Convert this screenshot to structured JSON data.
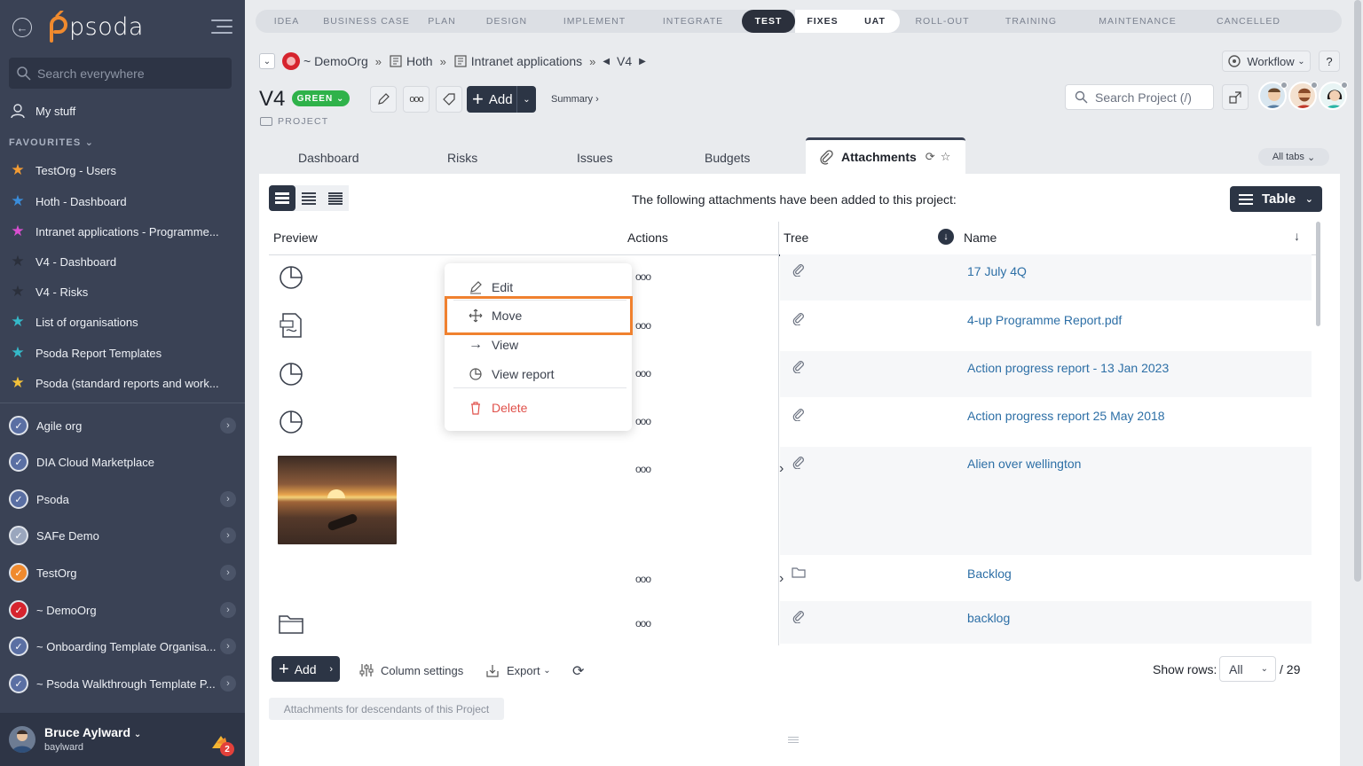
{
  "app": {
    "name": "psoda"
  },
  "sidebar": {
    "search_placeholder": "Search everywhere",
    "my_stuff": "My stuff",
    "favourites_label": "FAVOURITES",
    "favourites": [
      {
        "label": "TestOrg - Users",
        "color": "#f39c34"
      },
      {
        "label": "Hoth - Dashboard",
        "color": "#3a8ddb"
      },
      {
        "label": "Intranet applications - Programme...",
        "color": "#d94fd0"
      },
      {
        "label": "V4 - Dashboard",
        "color": "#2b303c"
      },
      {
        "label": "V4 - Risks",
        "color": "#2b303c"
      },
      {
        "label": "List of organisations",
        "color": "#35b9c9"
      },
      {
        "label": "Psoda Report Templates",
        "color": "#35b9c9"
      },
      {
        "label": "Psoda (standard reports and work...",
        "color": "#f3c13a"
      }
    ],
    "orgs": [
      {
        "label": "Agile org",
        "chevron": true
      },
      {
        "label": "DIA Cloud Marketplace",
        "chevron": false
      },
      {
        "label": "Psoda",
        "chevron": true
      },
      {
        "label": "SAFe Demo",
        "chevron": true
      },
      {
        "label": "TestOrg",
        "chevron": true
      },
      {
        "label": "~ DemoOrg",
        "chevron": true
      },
      {
        "label": "~ Onboarding Template Organisa...",
        "chevron": true
      },
      {
        "label": "~ Psoda Walkthrough Template P...",
        "chevron": true
      }
    ],
    "user": {
      "name": "Bruce Aylward",
      "handle": "baylward",
      "notifications": "2"
    }
  },
  "phases": [
    {
      "label": "IDEA",
      "state": "past"
    },
    {
      "label": "BUSINESS CASE",
      "state": "past"
    },
    {
      "label": "PLAN",
      "state": "past"
    },
    {
      "label": "DESIGN",
      "state": "past"
    },
    {
      "label": "IMPLEMENT",
      "state": "past"
    },
    {
      "label": "INTEGRATE",
      "state": "past"
    },
    {
      "label": "TEST",
      "state": "active"
    },
    {
      "label": "FIXES",
      "state": "future"
    },
    {
      "label": "UAT",
      "state": "future"
    },
    {
      "label": "ROLL-OUT",
      "state": "past"
    },
    {
      "label": "TRAINING",
      "state": "past"
    },
    {
      "label": "MAINTENANCE",
      "state": "past"
    },
    {
      "label": "CANCELLED",
      "state": "past"
    }
  ],
  "breadcrumb": {
    "org": "~ DemoOrg",
    "programme": "Hoth",
    "project_group": "Intranet applications",
    "current": "V4"
  },
  "header": {
    "workflow": "Workflow",
    "help": "?",
    "title": "V4",
    "status": "GREEN",
    "type": "PROJECT",
    "add_label": "Add",
    "summary_label": "Summary ›",
    "search_placeholder": "Search Project (/)"
  },
  "tabs": {
    "items": [
      "Dashboard",
      "Risks",
      "Issues",
      "Budgets"
    ],
    "active": "Attachments",
    "all_tabs": "All tabs"
  },
  "content": {
    "intro": "The following attachments have been added to this project:",
    "view_mode": "Table"
  },
  "table": {
    "columns": {
      "preview": "Preview",
      "actions": "Actions",
      "tree": "Tree",
      "name": "Name"
    },
    "rows": [
      {
        "name": "17 July 4Q",
        "preview": "report-icon",
        "tree_icon": "paperclip-icon",
        "expandable": false
      },
      {
        "name": "4-up Programme Report.pdf",
        "preview": "pdf-icon",
        "tree_icon": "paperclip-icon",
        "expandable": false
      },
      {
        "name": "Action progress report - 13 Jan 2023",
        "preview": "report-icon",
        "tree_icon": "paperclip-icon",
        "expandable": false
      },
      {
        "name": "Action progress report 25 May 2018",
        "preview": "report-icon",
        "tree_icon": "paperclip-icon",
        "expandable": false
      },
      {
        "name": "Alien over wellington",
        "preview": "photo",
        "tree_icon": "paperclip-icon",
        "expandable": true
      },
      {
        "name": "Backlog",
        "preview": "none",
        "tree_icon": "folder-icon",
        "expandable": true
      },
      {
        "name": "backlog",
        "preview": "folder-icon",
        "tree_icon": "paperclip-icon",
        "expandable": false
      }
    ]
  },
  "context_menu": {
    "items": [
      "Edit",
      "Move",
      "View",
      "View report",
      "Delete"
    ],
    "highlighted": "Move"
  },
  "footer": {
    "add": "Add",
    "column_settings": "Column settings",
    "export": "Export",
    "show_rows_label": "Show rows:",
    "show_rows_value": "All",
    "total": "/ 29",
    "descendants": "Attachments for descendants of this Project"
  },
  "colors": {
    "sidebar_bg": "#3a4255",
    "accent_dark": "#2c3545",
    "status_green": "#2fb24a",
    "link": "#2d6fa6",
    "highlight": "#f0812f",
    "delete": "#e0514b"
  }
}
